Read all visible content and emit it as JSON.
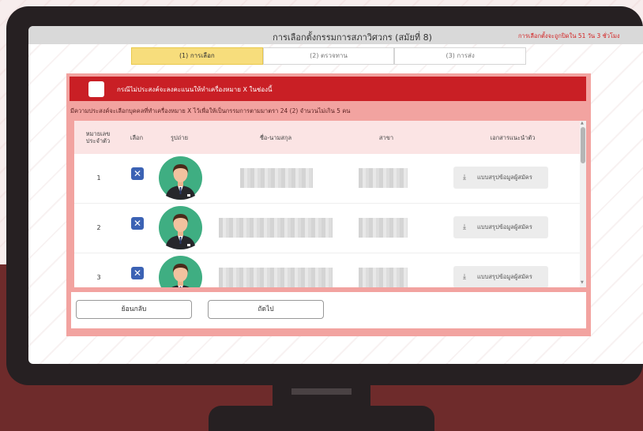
{
  "window": {
    "title": "การเลือกตั้งกรรมการสภาวิศวกร (สมัยที่ 8)",
    "notice": "การเลือกตั้งจะถูกปิดใน 51 วัน 3 ชั่วโมง"
  },
  "steps": [
    {
      "label": "(1) การเลือก",
      "active": true
    },
    {
      "label": "(2) ตรวจทาน",
      "active": false
    },
    {
      "label": "(3) การส่ง",
      "active": false
    }
  ],
  "banner": {
    "text": "กรณีไม่ประสงค์จะลงคะแนนให้ทำเครื่องหมาย X ในช่องนี้"
  },
  "subtitle": "มีความประสงค์จะเลือกบุคคลที่ทำเครื่องหมาย X ไว้เพื่อให้เป็นกรรมการตามมาตรา 24 (2) จำนวนไม่เกิน 5 คน",
  "table": {
    "headers": {
      "number": "หมายเลข ประจำตัว",
      "select": "เลือก",
      "photo": "รูปถ่าย",
      "name": "ชื่อ-นามสกุล",
      "branch": "สาขา",
      "docs": "เอกสารแนะนำตัว"
    },
    "rows": [
      {
        "number": "1",
        "selected": "✕",
        "doc_label": "แบบสรุปข้อมูลผู้สมัคร"
      },
      {
        "number": "2",
        "selected": "✕",
        "doc_label": "แบบสรุปข้อมูลผู้สมัคร"
      },
      {
        "number": "3",
        "selected": "✕",
        "doc_label": "แบบสรุปข้อมูลผู้สมัคร"
      }
    ]
  },
  "footer": {
    "back_label": "ย้อนกลับ",
    "next_label": "ถัดไป"
  },
  "colors": {
    "banner": "#c91f25",
    "panel": "#f2a3a0",
    "active_step": "#f7dd7c",
    "checkbox": "#3b62b4",
    "avatar_bg": "#3fae82"
  },
  "icons": {
    "download": "download-icon",
    "check": "x-mark-icon",
    "avatar": "person-avatar-icon"
  }
}
